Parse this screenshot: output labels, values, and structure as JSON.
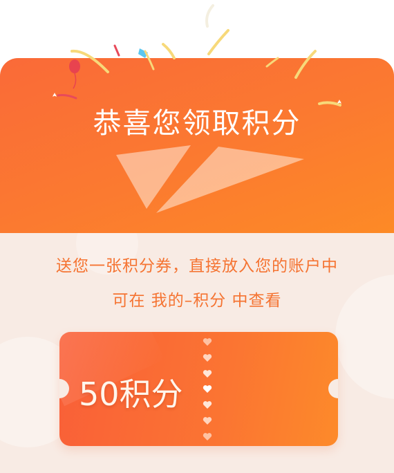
{
  "dialog": {
    "title": "恭喜您领取积分",
    "message_line1": "送您一张积分券，直接放入您的账户中",
    "message_line2": "可在 我的–积分 中查看"
  },
  "coupon": {
    "value_label": "50积分"
  },
  "colors": {
    "header_start": "#fa6a38",
    "header_end": "#fd8a26",
    "body_bg": "#f8ebe4",
    "message_text": "#f57331",
    "ticket_start": "#f95f38",
    "ticket_end": "#fd8a2a"
  },
  "icons": {
    "balloon": "balloon-icon",
    "confetti": "confetti-icon",
    "heart": "heart-icon",
    "paper_plane": "paper-plane-icon"
  }
}
